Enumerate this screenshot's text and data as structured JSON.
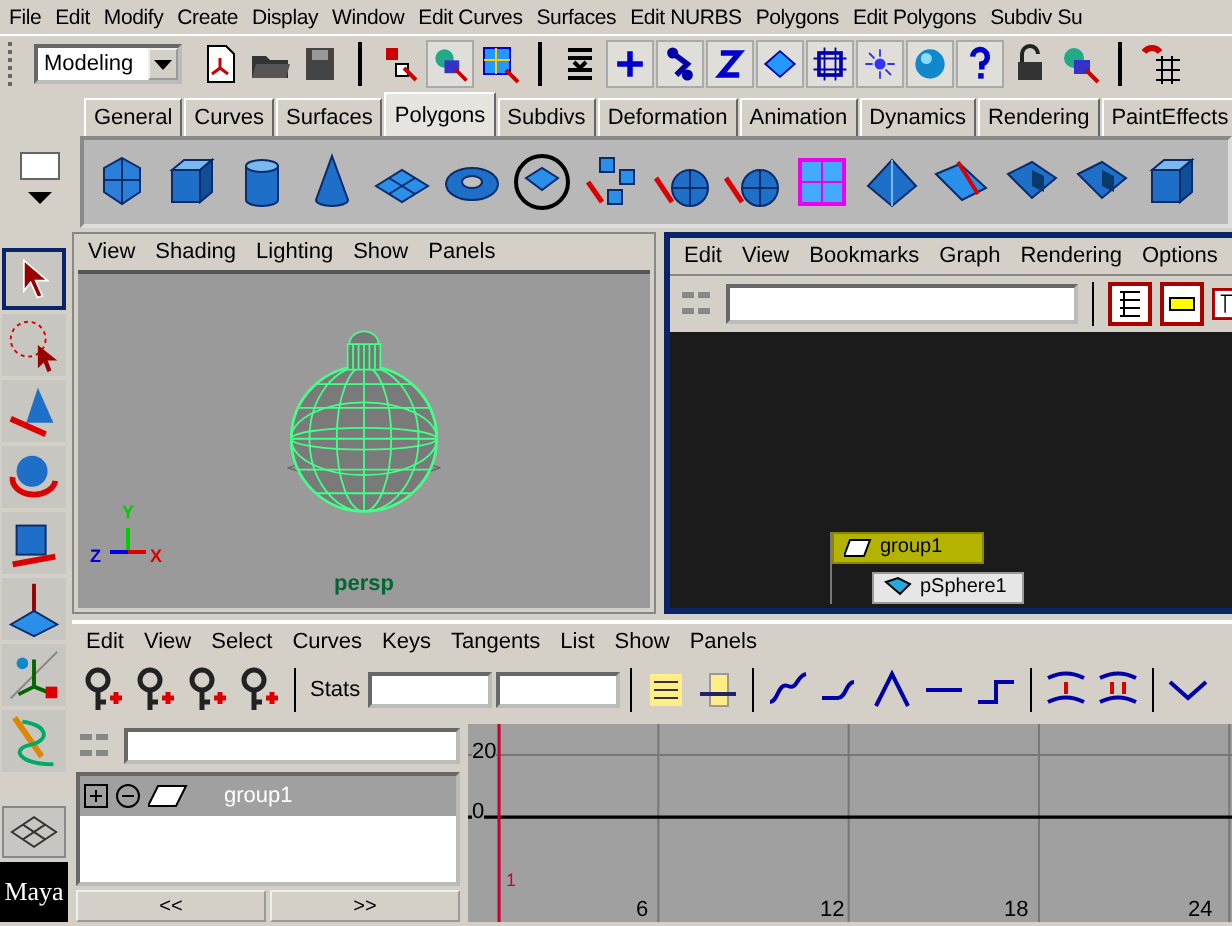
{
  "menu_bar": [
    "File",
    "Edit",
    "Modify",
    "Create",
    "Display",
    "Window",
    "Edit Curves",
    "Surfaces",
    "Edit NURBS",
    "Polygons",
    "Edit Polygons",
    "Subdiv Su"
  ],
  "toolbar": {
    "mode": "Modeling"
  },
  "shelf_tabs": [
    {
      "label": "General",
      "selected": false
    },
    {
      "label": "Curves",
      "selected": false
    },
    {
      "label": "Surfaces",
      "selected": false
    },
    {
      "label": "Polygons",
      "selected": true
    },
    {
      "label": "Subdivs",
      "selected": false
    },
    {
      "label": "Deformation",
      "selected": false
    },
    {
      "label": "Animation",
      "selected": false
    },
    {
      "label": "Dynamics",
      "selected": false
    },
    {
      "label": "Rendering",
      "selected": false
    },
    {
      "label": "PaintEffects",
      "selected": false
    }
  ],
  "viewport": {
    "menu": [
      "View",
      "Shading",
      "Lighting",
      "Show",
      "Panels"
    ],
    "axis_labels": [
      "Y",
      "Z",
      "X"
    ],
    "camera": "persp"
  },
  "hypergraph": {
    "menu": [
      "Edit",
      "View",
      "Bookmarks",
      "Graph",
      "Rendering",
      "Options"
    ],
    "nodes": [
      {
        "label": "group1",
        "selected": true
      },
      {
        "label": "pSphere1",
        "selected": false
      }
    ]
  },
  "graph_editor": {
    "menu": [
      "Edit",
      "View",
      "Select",
      "Curves",
      "Keys",
      "Tangents",
      "List",
      "Show",
      "Panels"
    ],
    "stats_label": "Stats",
    "outliner_items": [
      {
        "label": "group1",
        "selected": true
      }
    ],
    "nav_buttons": [
      "<<",
      ">>"
    ],
    "graph": {
      "y_labels": [
        "20",
        "0"
      ],
      "x_labels": [
        "6",
        "12",
        "18",
        "24"
      ],
      "current_frame": "1"
    }
  },
  "logo": "Maya"
}
